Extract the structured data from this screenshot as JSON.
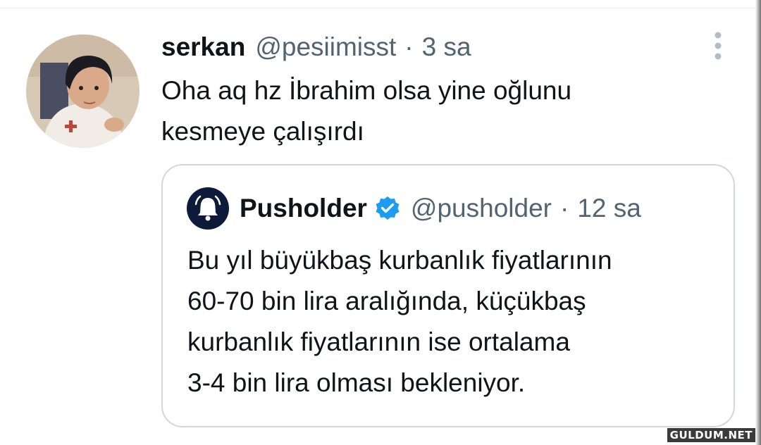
{
  "tweet": {
    "display_name": "serkan",
    "handle": "@pesiimisst",
    "separator": "·",
    "timestamp": "3 sa",
    "text_line1": "Oha aq hz İbrahim olsa yine oğlunu",
    "text_line2": "kesmeye çalışırdı",
    "more_icon": "more-vertical-icon"
  },
  "quoted_tweet": {
    "display_name": "Pusholder",
    "verified": true,
    "handle": "@pusholder",
    "separator": "·",
    "timestamp": "12 sa",
    "text_line1": "Bu yıl büyükbaş kurbanlık fiyatlarının",
    "text_line2": "60-70 bin lira aralığında, küçükbaş",
    "text_line3": "kurbanlık fiyatlarının ise ortalama",
    "text_line4": "3-4 bin lira olması bekleniyor.",
    "avatar_icon": "bell-icon"
  },
  "watermark": {
    "text": "GULDUM.NET"
  },
  "colors": {
    "text_primary": "#0f1419",
    "text_secondary": "#536471",
    "border": "#cfd9de",
    "verified_blue": "#1d9bf0",
    "quote_avatar_bg": "#0e1a3a"
  }
}
